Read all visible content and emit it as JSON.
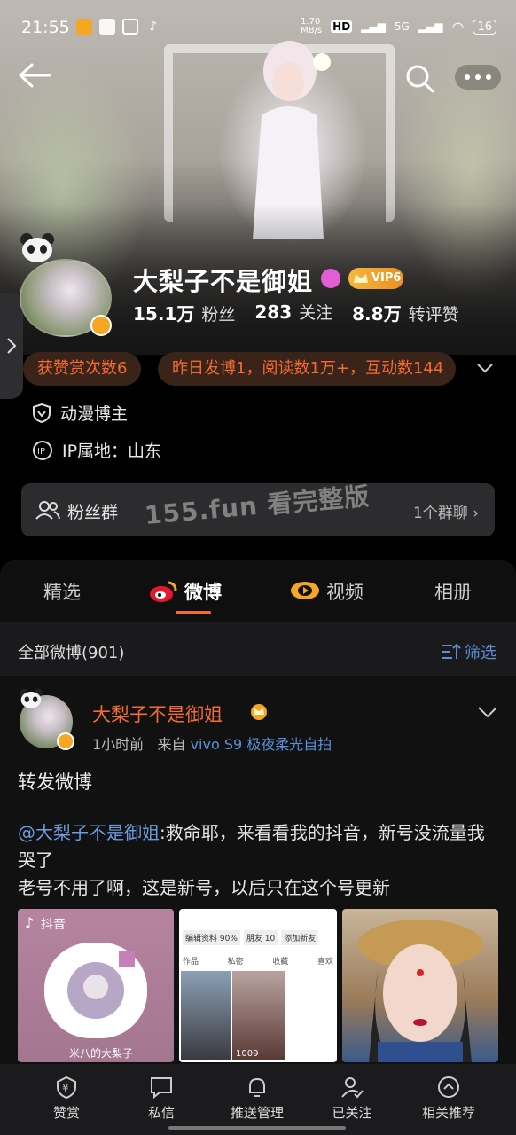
{
  "status_bar": {
    "time": "21:55",
    "net_speed": "1.70\nMB/s",
    "battery": "16",
    "network": "5G"
  },
  "profile": {
    "name": "大梨子不是御姐",
    "vip_label": "VIP6",
    "stats": [
      {
        "value": "15.1万",
        "label": "粉丝"
      },
      {
        "value": "283",
        "label": "关注"
      },
      {
        "value": "8.8万",
        "label": "转评赞"
      }
    ],
    "pill_left": "获赞赏次数6",
    "pill_right": "昨日发博1，阅读数1万+，互动数144",
    "tag": "动漫博主",
    "ip": "IP属地：山东",
    "fans_group": {
      "label": "粉丝群",
      "count": "1个群聊"
    }
  },
  "watermark": "155.fun 看完整版",
  "tabs": [
    "精选",
    "微博",
    "视频",
    "相册"
  ],
  "active_tab": "微博",
  "filter_bar": {
    "all_label": "全部微博(901)",
    "filter_label": "筛选"
  },
  "post": {
    "author": "大梨子不是御姐",
    "time": "1小时前",
    "from_prefix": "来自",
    "source": "vivo S9 极夜柔光自拍",
    "title": "转发微博",
    "mention": "@大梨子不是御姐",
    "body_line1": ":救命耶，来看看我的抖音，新号没流量我哭了",
    "body_line2": "老号不用了啊，这是新号，以后只在这个号更新",
    "image1": {
      "brand": "抖音",
      "caption": "一米八的大梨子"
    },
    "image2": {
      "tags": [
        "编辑资料 90%",
        "朋友 10",
        "添加新友"
      ],
      "tabs": [
        "作品",
        "私密",
        "收藏",
        "喜欢"
      ],
      "count": "1009"
    }
  },
  "bottom_nav": [
    "赞赏",
    "私信",
    "推送管理",
    "已关注",
    "相关推荐"
  ],
  "colors": {
    "accent": "#f26b33",
    "link": "#5b8fd9",
    "vip": "#f6a623"
  }
}
